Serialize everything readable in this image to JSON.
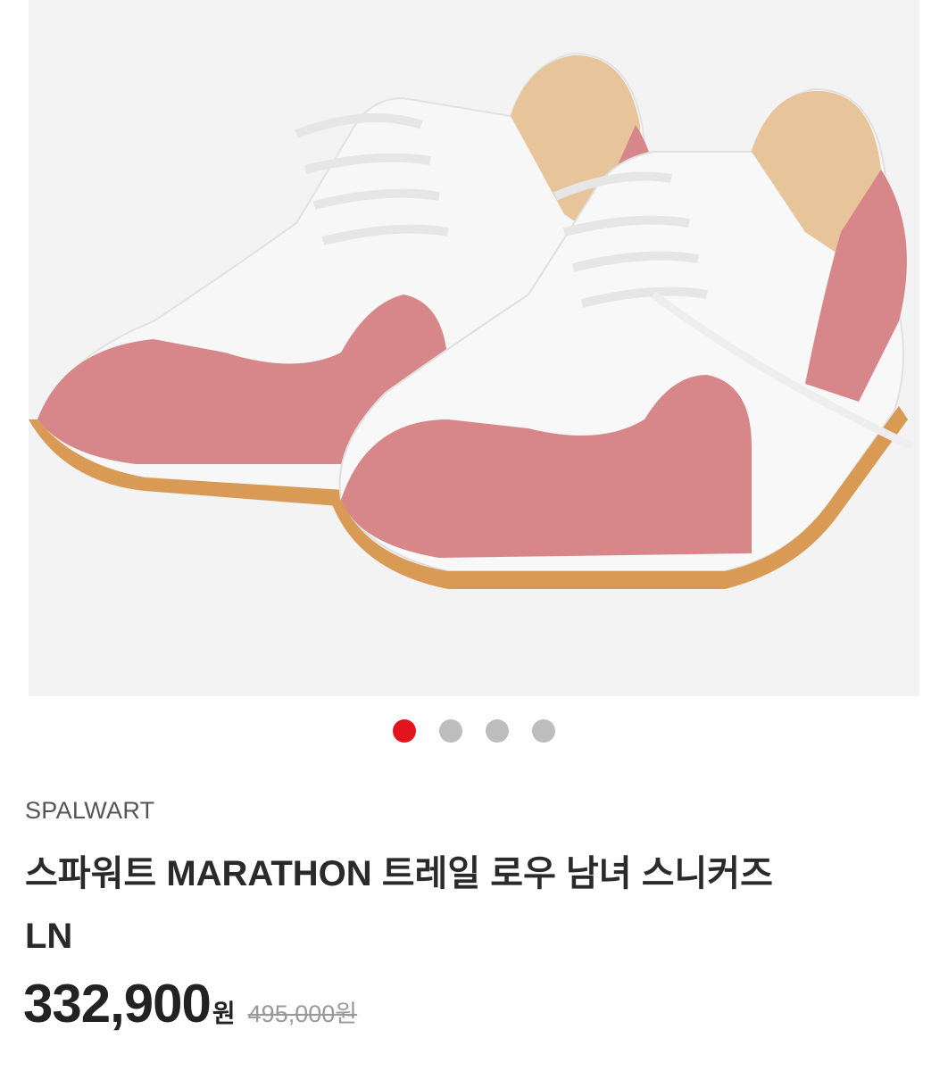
{
  "gallery": {
    "image_alt": "product-photo-sneakers",
    "slide_count": 4,
    "active_slide": 1
  },
  "product": {
    "brand": "SPALWART",
    "title_line1": "스파워트 MARATHON 트레일 로우 남녀 스니커즈",
    "title_line2": "LN",
    "price": "332,900",
    "price_unit": "원",
    "original_price": "495,000",
    "original_price_unit": "원"
  },
  "colors": {
    "active_dot": "#e4141e",
    "inactive_dot": "#bdbdbd",
    "suede": "#d7878a",
    "sole": "#d99a55"
  }
}
